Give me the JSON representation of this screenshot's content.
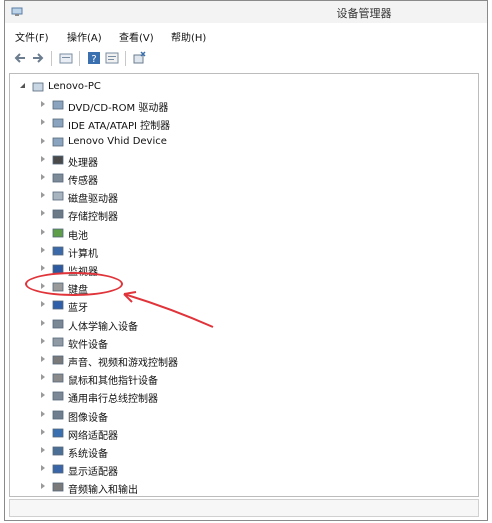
{
  "window": {
    "title": "设备管理器"
  },
  "menu": {
    "items": [
      {
        "label": "文件(F)"
      },
      {
        "label": "操作(A)"
      },
      {
        "label": "查看(V)"
      },
      {
        "label": "帮助(H)"
      }
    ]
  },
  "toolbar": {
    "buttons": [
      {
        "icon": "back-arrow-icon"
      },
      {
        "icon": "forward-arrow-icon"
      },
      {
        "icon": "properties-icon"
      },
      {
        "icon": "help-icon"
      },
      {
        "icon": "show-hidden-icon"
      },
      {
        "icon": "scan-hardware-icon"
      }
    ]
  },
  "tree": {
    "root": {
      "label": "Lenovo-PC",
      "icon": "computer-icon",
      "expanded": true
    },
    "items": [
      {
        "label": "DVD/CD-ROM 驱动器",
        "icon": "dvd-drive-icon"
      },
      {
        "label": "IDE ATA/ATAPI 控制器",
        "icon": "ide-controller-icon"
      },
      {
        "label": "Lenovo Vhid Device",
        "icon": "hid-device-icon"
      },
      {
        "label": "处理器",
        "icon": "processor-icon"
      },
      {
        "label": "传感器",
        "icon": "sensor-icon"
      },
      {
        "label": "磁盘驱动器",
        "icon": "disk-drive-icon"
      },
      {
        "label": "存储控制器",
        "icon": "storage-controller-icon"
      },
      {
        "label": "电池",
        "icon": "battery-icon"
      },
      {
        "label": "计算机",
        "icon": "computer-small-icon"
      },
      {
        "label": "监视器",
        "icon": "monitor-icon"
      },
      {
        "label": "键盘",
        "icon": "keyboard-icon"
      },
      {
        "label": "蓝牙",
        "icon": "bluetooth-icon"
      },
      {
        "label": "人体学输入设备",
        "icon": "hid-input-icon"
      },
      {
        "label": "软件设备",
        "icon": "software-device-icon"
      },
      {
        "label": "声音、视频和游戏控制器",
        "icon": "sound-icon"
      },
      {
        "label": "鼠标和其他指针设备",
        "icon": "mouse-icon"
      },
      {
        "label": "通用串行总线控制器",
        "icon": "usb-icon"
      },
      {
        "label": "图像设备",
        "icon": "imaging-device-icon"
      },
      {
        "label": "网络适配器",
        "icon": "network-adapter-icon"
      },
      {
        "label": "系统设备",
        "icon": "system-device-icon"
      },
      {
        "label": "显示适配器",
        "icon": "display-adapter-icon"
      },
      {
        "label": "音频输入和输出",
        "icon": "audio-io-icon"
      }
    ]
  },
  "annotation": {
    "highlighted_item": "键盘",
    "color": "#e0343a"
  },
  "colors": {
    "accent": "#e0343a",
    "window_border": "#8a8a8a",
    "titlebar": "#f3f3f3"
  }
}
